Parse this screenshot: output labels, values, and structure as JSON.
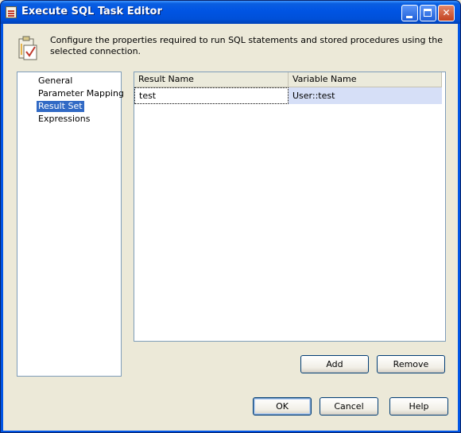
{
  "window": {
    "title": "Execute SQL Task Editor"
  },
  "header": {
    "description": "Configure the properties required to run SQL statements and stored procedures using the selected connection."
  },
  "nav": {
    "items": [
      {
        "label": "General",
        "selected": false
      },
      {
        "label": "Parameter Mapping",
        "selected": false
      },
      {
        "label": "Result Set",
        "selected": true
      },
      {
        "label": "Expressions",
        "selected": false
      }
    ]
  },
  "result_grid": {
    "columns": [
      "Result Name",
      "Variable Name"
    ],
    "rows": [
      {
        "result_name": "test",
        "variable_name": "User::test"
      }
    ]
  },
  "grid_buttons": {
    "add": "Add",
    "remove": "Remove"
  },
  "footer_buttons": {
    "ok": "OK",
    "cancel": "Cancel",
    "help": "Help"
  },
  "colors": {
    "titlebar": "#0054e3",
    "selection": "#316ac5",
    "row_highlight": "#d6dff7",
    "dialog_face": "#ece9d8"
  },
  "icons": {
    "title": "sql-task-icon",
    "header": "task-properties-icon",
    "minimize": "minimize-icon",
    "maximize": "maximize-icon",
    "close": "close-icon"
  }
}
